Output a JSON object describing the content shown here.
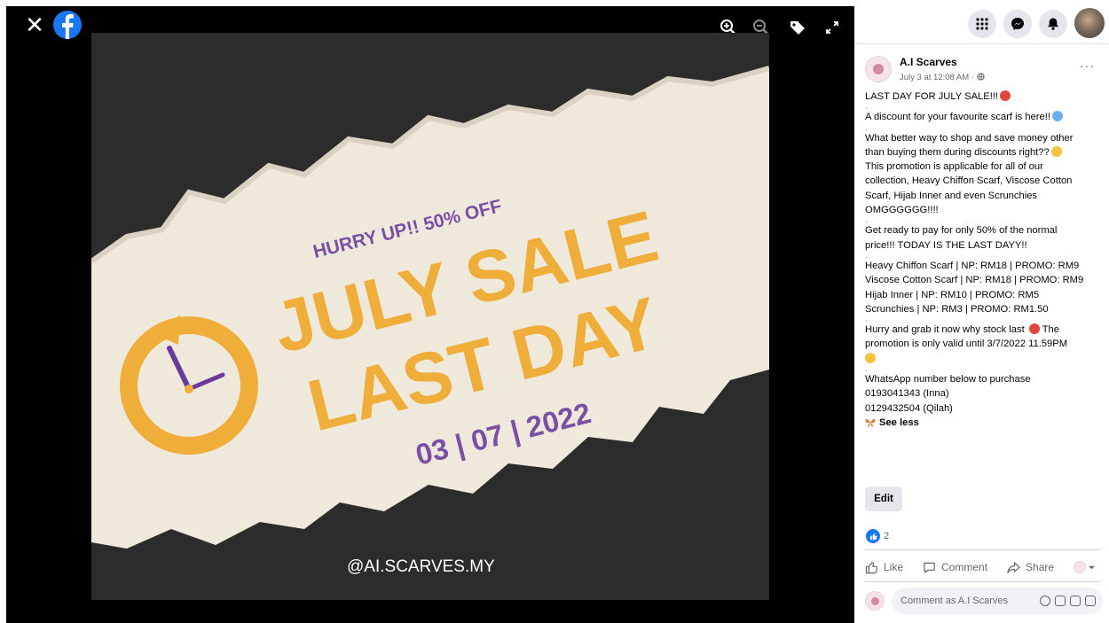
{
  "viewer": {
    "close_symbol": "✕",
    "toolbar_icons": [
      "zoom-in-icon",
      "zoom-out-icon",
      "tag-icon",
      "fullscreen-icon"
    ],
    "photo": {
      "headline_top": "HURRY UP!! 50% OFF",
      "headline_line1": "JULY SALE",
      "headline_line2": "LAST DAY",
      "date": "03 | 07 | 2022",
      "handle": "@AI.SCARVES.MY"
    },
    "colors": {
      "orange": "#efad3a",
      "purple": "#7b4fa6",
      "paper": "#efe9dc",
      "background": "#2c2c2c"
    }
  },
  "topbar": {
    "icons": [
      "menu-grid-icon",
      "messenger-icon",
      "notifications-icon",
      "profile-avatar"
    ]
  },
  "post": {
    "author": "A.I Scarves",
    "time": "July 3 at 12:08 AM ·",
    "more": "···",
    "lines": {
      "l1": "LAST DAY FOR JULY SALE!!!",
      "l2": "A discount for your favourite scarf is here!!",
      "l3": "What better way to shop and save money other",
      "l4": "than buying them during discounts right??",
      "l5": "This promotion is applicable for all of our",
      "l6": "collection, Heavy Chiffon Scarf, Viscose Cotton",
      "l7": "Scarf, Hijab Inner and even Scrunchies",
      "l8": "OMGGGGGG!!!!",
      "l9": "Get ready to pay for only 50% of the normal",
      "l10": "price!!! TODAY IS THE LAST DAYY!!",
      "l11": "Heavy Chiffon Scarf | NP: RM18 | PROMO: RM9",
      "l12": "Viscose Cotton Scarf | NP: RM18 | PROMO: RM9",
      "l13": "Hijab Inner | NP: RM10 | PROMO: RM5",
      "l14": "Scrunchies | NP: RM3 | PROMO: RM1.50",
      "l15": "Hurry and grab it now why stock last",
      "l15b": "The",
      "l16": "promotion is only valid until 3/7/2022 11.59PM",
      "l17": "WhatsApp number below to purchase",
      "l18": "0193041343 (Inna)",
      "l19": "0129432504 (Qilah)"
    },
    "dot": ".",
    "see_less": "See less",
    "edit_label": "Edit",
    "reaction_count": "2"
  },
  "actions": {
    "like": "Like",
    "comment": "Comment",
    "share": "Share"
  },
  "comment_box": {
    "placeholder": "Comment as A.I Scarves"
  }
}
